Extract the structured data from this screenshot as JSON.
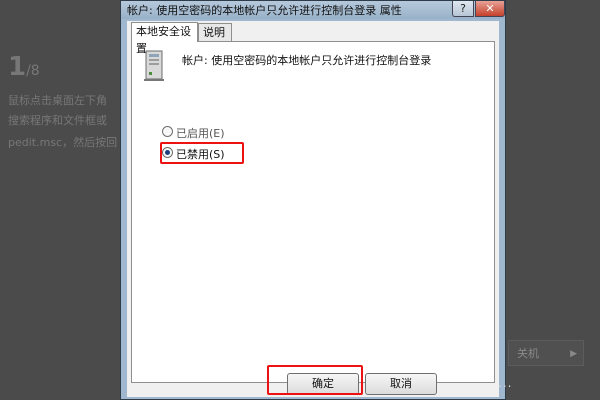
{
  "background": {
    "step_number": "1",
    "step_total": "/8",
    "lines": [
      "鼠标点击桌面左下角",
      "搜索程序和文件框或",
      "pedit.msc，然后按回"
    ],
    "right_box_label": "关机",
    "watermark": "..."
  },
  "dialog": {
    "title": "帐户: 使用空密码的本地帐户只允许进行控制台登录 属性",
    "help_label": "?",
    "close_label": "✕",
    "tabs": [
      {
        "label": "本地安全设置",
        "active": true
      },
      {
        "label": "说明",
        "active": false
      }
    ],
    "policy_name": "帐户: 使用空密码的本地帐户只允许进行控制台登录",
    "options": [
      {
        "label": "已启用(E)",
        "selected": false
      },
      {
        "label": "已禁用(S)",
        "selected": true
      }
    ],
    "buttons": {
      "ok": "确定",
      "cancel": "取消"
    }
  },
  "colors": {
    "highlight": "#ee1111",
    "titlebar": "#98b1c8",
    "close": "#c5412b"
  }
}
